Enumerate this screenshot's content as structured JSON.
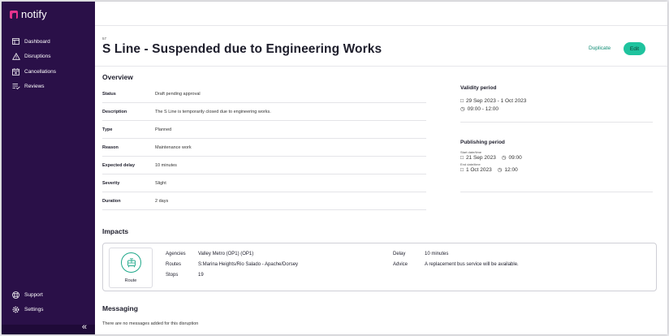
{
  "app": {
    "name": "notify"
  },
  "sidebar": {
    "items": [
      {
        "label": "Dashboard",
        "icon": "dashboard-icon"
      },
      {
        "label": "Disruptions",
        "icon": "warning-icon"
      },
      {
        "label": "Cancellations",
        "icon": "calendar-x-icon"
      },
      {
        "label": "Reviews",
        "icon": "review-list-icon"
      }
    ],
    "bottom_items": [
      {
        "label": "Support",
        "icon": "support-icon"
      },
      {
        "label": "Settings",
        "icon": "gear-icon"
      }
    ],
    "collapse_glyph": "«"
  },
  "header": {
    "id": "57",
    "title": "S Line - Suspended due to Engineering Works",
    "duplicate_label": "Duplicate",
    "edit_label": "Edit"
  },
  "overview": {
    "heading": "Overview",
    "rows": [
      {
        "label": "Status",
        "value": "Draft pending approval"
      },
      {
        "label": "Description",
        "value": "The S Line is temporarily closed due to engineering works."
      },
      {
        "label": "Type",
        "value": "Planned"
      },
      {
        "label": "Reason",
        "value": "Maintenance work"
      },
      {
        "label": "Expected delay",
        "value": "10 minutes"
      },
      {
        "label": "Severity",
        "value": "Slight"
      },
      {
        "label": "Duration",
        "value": "2 days"
      }
    ]
  },
  "validity": {
    "title": "Validity period",
    "dates": "29 Sep 2023 - 1 Oct 2023",
    "times": "09:00 - 12:00"
  },
  "publishing": {
    "title": "Publishing period",
    "start_label": "Start date/time",
    "start_date": "21 Sep 2023",
    "start_time": "09:00",
    "end_label": "End date/time",
    "end_date": "1 Oct 2023",
    "end_time": "12:00"
  },
  "impacts": {
    "heading": "Impacts",
    "route_label": "Route",
    "agencies_label": "Agencies",
    "agencies_value": "Valley Metro (OP1) (OP1)",
    "routes_label": "Routes",
    "routes_value": "S:Marina Heights/Rio Salado - Apache/Dorsey",
    "stops_label": "Stops",
    "stops_value": "19",
    "delay_label": "Delay",
    "delay_value": "10 minutes",
    "advice_label": "Advice",
    "advice_value": "A replacement bus service will be available."
  },
  "messaging": {
    "heading": "Messaging",
    "empty_text": "There are no messages added for this disruption"
  },
  "colors": {
    "sidebar_bg": "#2a1048",
    "brand_pink": "#e6338c",
    "accent_green": "#1fc39e",
    "link_green": "#0f8c74"
  }
}
